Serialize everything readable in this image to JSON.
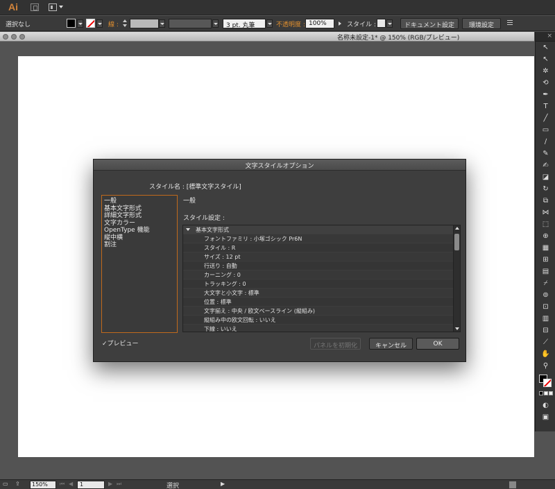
{
  "app": {
    "logo": "Ai",
    "icons": [
      "bridge-icon",
      "arrange-documents-icon"
    ]
  },
  "control_bar": {
    "selection_status": "選択なし",
    "stroke_label": "線 :",
    "brush_value": "3 pt. 丸筆",
    "opacity_label": "不透明度 :",
    "opacity_value": "100%",
    "style_label": "スタイル :",
    "document_setup_button": "ドキュメント設定",
    "preferences_button": "環境設定",
    "colors": {
      "fill": "#000000",
      "accent": "#e2902f"
    }
  },
  "document": {
    "tab_title": "名称未設定-1* @ 150% (RGB/プレビュー)"
  },
  "tools": {
    "items": [
      {
        "name": "selection-tool-icon",
        "glyph": "↖"
      },
      {
        "name": "direct-selection-tool-icon",
        "glyph": "↖"
      },
      {
        "name": "magic-wand-tool-icon",
        "glyph": "✲"
      },
      {
        "name": "lasso-tool-icon",
        "glyph": "⟲"
      },
      {
        "name": "pen-tool-icon",
        "glyph": "✒"
      },
      {
        "name": "type-tool-icon",
        "glyph": "T"
      },
      {
        "name": "line-tool-icon",
        "glyph": "╱"
      },
      {
        "name": "rectangle-tool-icon",
        "glyph": "▭"
      },
      {
        "name": "paintbrush-tool-icon",
        "glyph": "∕"
      },
      {
        "name": "pencil-tool-icon",
        "glyph": "✎"
      },
      {
        "name": "blob-brush-tool-icon",
        "glyph": "✍"
      },
      {
        "name": "eraser-tool-icon",
        "glyph": "◪"
      },
      {
        "name": "rotate-tool-icon",
        "glyph": "↻"
      },
      {
        "name": "scale-tool-icon",
        "glyph": "⧉"
      },
      {
        "name": "width-tool-icon",
        "glyph": "⋈"
      },
      {
        "name": "free-transform-tool-icon",
        "glyph": "⬚"
      },
      {
        "name": "shape-builder-tool-icon",
        "glyph": "⊕"
      },
      {
        "name": "perspective-grid-tool-icon",
        "glyph": "▦"
      },
      {
        "name": "mesh-tool-icon",
        "glyph": "⊞"
      },
      {
        "name": "gradient-tool-icon",
        "glyph": "▤"
      },
      {
        "name": "eyedropper-tool-icon",
        "glyph": "⌿"
      },
      {
        "name": "blend-tool-icon",
        "glyph": "⊚"
      },
      {
        "name": "symbol-sprayer-tool-icon",
        "glyph": "⊡"
      },
      {
        "name": "column-graph-tool-icon",
        "glyph": "▥"
      },
      {
        "name": "artboard-tool-icon",
        "glyph": "⊟"
      },
      {
        "name": "slice-tool-icon",
        "glyph": "⟋"
      },
      {
        "name": "hand-tool-icon",
        "glyph": "✋"
      },
      {
        "name": "zoom-tool-icon",
        "glyph": "⚲"
      }
    ],
    "swatch_fill": "#000000",
    "swatch_stroke": "#ffffff"
  },
  "dialog": {
    "title": "文字スタイルオプション",
    "style_name": "スタイル名 : [標準文字スタイル]",
    "categories": [
      "一般",
      "基本文字形式",
      "詳細文字形式",
      "文字カラー",
      "OpenType 機能",
      "縦中横",
      "割注"
    ],
    "section_title": "一般",
    "settings_label": "スタイル設定 :",
    "tree_header": "基本文字形式",
    "tree_rows": [
      "フォントファミリ : 小塚ゴシック Pr6N",
      "スタイル : R",
      "サイズ : 12 pt",
      "行送り : 自動",
      "カーニング : 0",
      "トラッキング : 0",
      "大文字と小文字 : 標準",
      "位置 : 標準",
      "文字揃え : 中央 / 欧文ベースライン (縦組み)",
      "縦組み中の欧文回転 : いいえ",
      "下線 : いいえ"
    ],
    "preview_label": "✓プレビュー",
    "reset_button": "パネルを初期化",
    "cancel_button": "キャンセル",
    "ok_button": "OK"
  },
  "status_bar": {
    "zoom": "150%",
    "page": "1",
    "status": "選択"
  }
}
